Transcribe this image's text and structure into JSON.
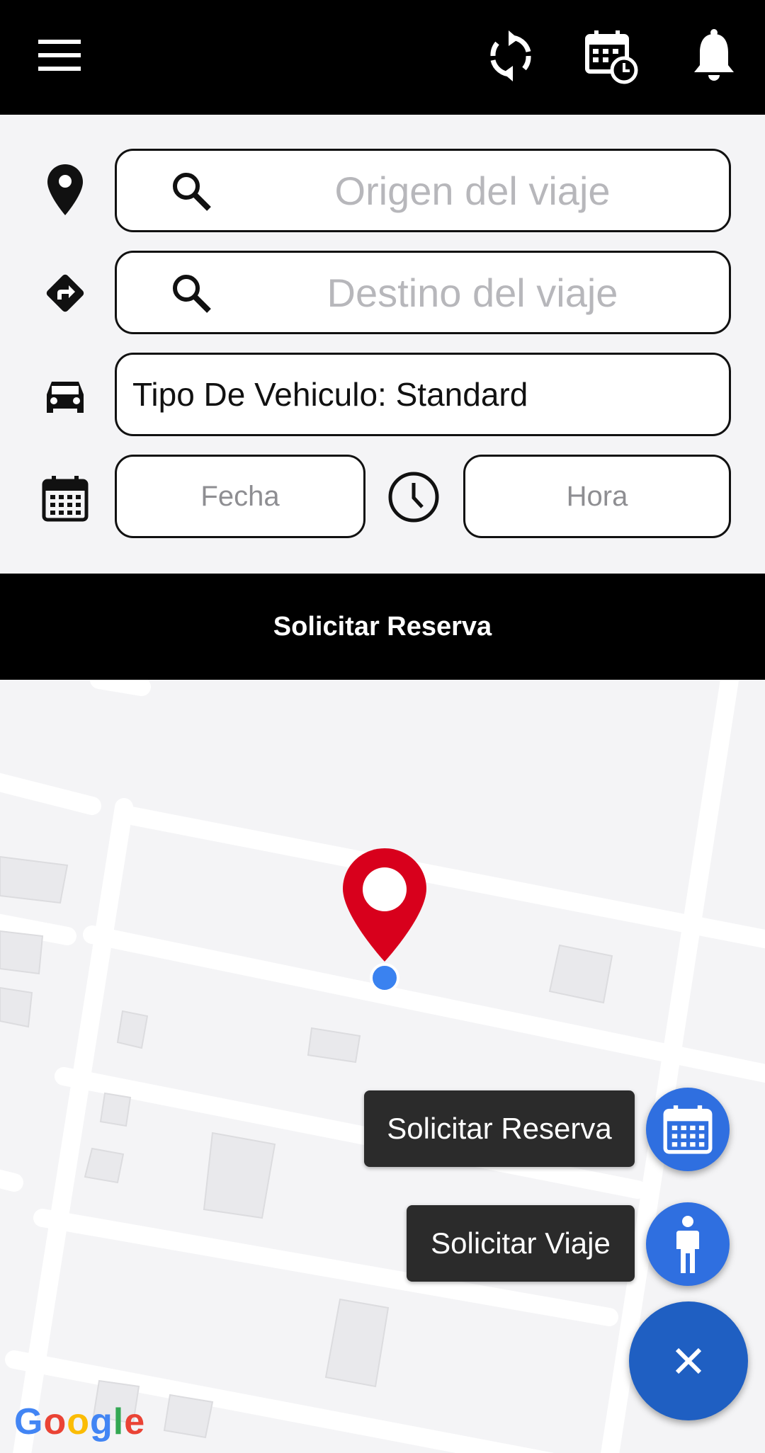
{
  "icons": {
    "menu": "hamburger-menu-icon",
    "refresh": "refresh-icon",
    "schedule": "calendar-clock-icon",
    "notifications": "bell-icon",
    "origin": "location-pin-icon",
    "destination": "directions-icon",
    "vehicle": "car-icon",
    "date": "calendar-icon",
    "time": "clock-icon"
  },
  "form": {
    "origin_placeholder": "Origen del viaje",
    "destination_placeholder": "Destino del viaje",
    "vehicle_type": "Tipo De Vehiculo: Standard",
    "date_placeholder": "Fecha",
    "time_placeholder": "Hora"
  },
  "reserve_bar": {
    "label": "Solicitar Reserva"
  },
  "fab_menu": {
    "reserve_label": "Solicitar Reserva",
    "trip_label": "Solicitar Viaje"
  },
  "map": {
    "attribution": "Google"
  },
  "colors": {
    "topbar": "#000000",
    "pin": "#d8001c",
    "fab_small": "#2f6fe0",
    "fab_main": "#1f5fc2"
  }
}
